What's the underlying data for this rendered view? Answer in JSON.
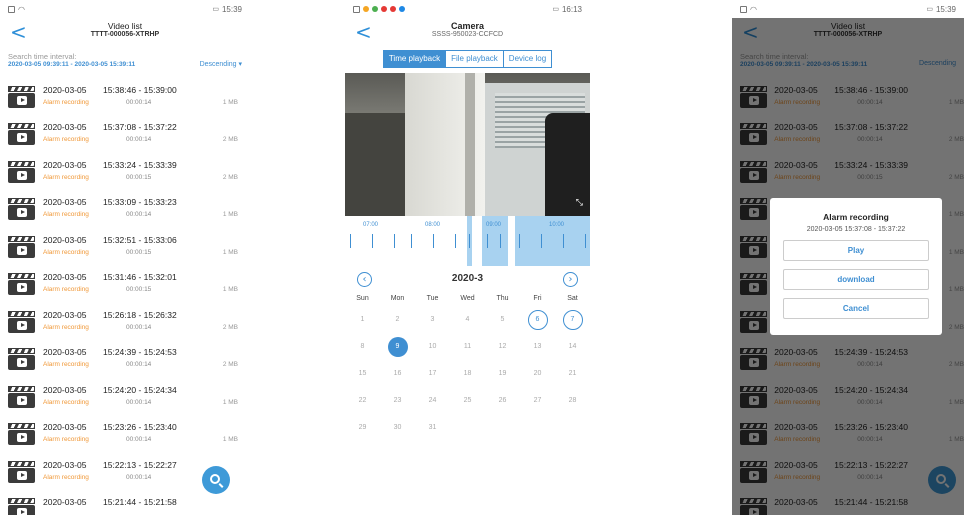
{
  "videoList": {
    "status": {
      "left": "",
      "right": "15:39"
    },
    "title": "Video list",
    "device": "TTTT-000056-XTRHP",
    "search_label": "Search time interval:",
    "search_range": "2020-03-05 09:39:11 - 2020-03-05 15:39:11",
    "sort": "Descending",
    "records": [
      {
        "date": "2020-03-05",
        "time": "15:38:46 - 15:39:00",
        "type": "Alarm recording",
        "duration": "00:00:14",
        "size": "1 MB"
      },
      {
        "date": "2020-03-05",
        "time": "15:37:08 - 15:37:22",
        "type": "Alarm recording",
        "duration": "00:00:14",
        "size": "2 MB"
      },
      {
        "date": "2020-03-05",
        "time": "15:33:24 - 15:33:39",
        "type": "Alarm recording",
        "duration": "00:00:15",
        "size": "2 MB"
      },
      {
        "date": "2020-03-05",
        "time": "15:33:09 - 15:33:23",
        "type": "Alarm recording",
        "duration": "00:00:14",
        "size": "1 MB"
      },
      {
        "date": "2020-03-05",
        "time": "15:32:51 - 15:33:06",
        "type": "Alarm recording",
        "duration": "00:00:15",
        "size": "1 MB"
      },
      {
        "date": "2020-03-05",
        "time": "15:31:46 - 15:32:01",
        "type": "Alarm recording",
        "duration": "00:00:15",
        "size": "1 MB"
      },
      {
        "date": "2020-03-05",
        "time": "15:26:18 - 15:26:32",
        "type": "Alarm recording",
        "duration": "00:00:14",
        "size": "2 MB"
      },
      {
        "date": "2020-03-05",
        "time": "15:24:39 - 15:24:53",
        "type": "Alarm recording",
        "duration": "00:00:14",
        "size": "2 MB"
      },
      {
        "date": "2020-03-05",
        "time": "15:24:20 - 15:24:34",
        "type": "Alarm recording",
        "duration": "00:00:14",
        "size": "1 MB"
      },
      {
        "date": "2020-03-05",
        "time": "15:23:26 - 15:23:40",
        "type": "Alarm recording",
        "duration": "00:00:14",
        "size": "1 MB"
      },
      {
        "date": "2020-03-05",
        "time": "15:22:13 - 15:22:27",
        "type": "Alarm recording",
        "duration": "00:00:14",
        "size": ""
      },
      {
        "date": "2020-03-05",
        "time": "15:21:44 - 15:21:58",
        "type": "",
        "duration": "",
        "size": ""
      }
    ]
  },
  "camera": {
    "status": {
      "right": "16:13"
    },
    "title": "Camera",
    "device": "SSSS-950023-CCFCD",
    "tabs": [
      "Time playback",
      "File playback",
      "Device log"
    ],
    "timeline_labels": [
      "07:00",
      "08:00",
      "09:00",
      "10:00"
    ],
    "month": "2020-3",
    "weekdays": [
      "Sun",
      "Mon",
      "Tue",
      "Wed",
      "Thu",
      "Fri",
      "Sat"
    ],
    "days": [
      "1",
      "2",
      "3",
      "4",
      "5",
      "6",
      "7",
      "8",
      "9",
      "10",
      "11",
      "12",
      "13",
      "14",
      "15",
      "16",
      "17",
      "18",
      "19",
      "20",
      "21",
      "22",
      "23",
      "24",
      "25",
      "26",
      "27",
      "28",
      "29",
      "30",
      "31"
    ],
    "ringed_days": [
      "6",
      "7"
    ],
    "selected_day": "9"
  },
  "dialog": {
    "title": "Alarm recording",
    "subtitle": "2020-03-05  15:37:08 - 15:37:22",
    "play": "Play",
    "download": "download",
    "cancel": "Cancel"
  },
  "colors": {
    "accent": "#3f8fd2",
    "alarm": "#f09838",
    "highlight": "#a8d2f0"
  }
}
